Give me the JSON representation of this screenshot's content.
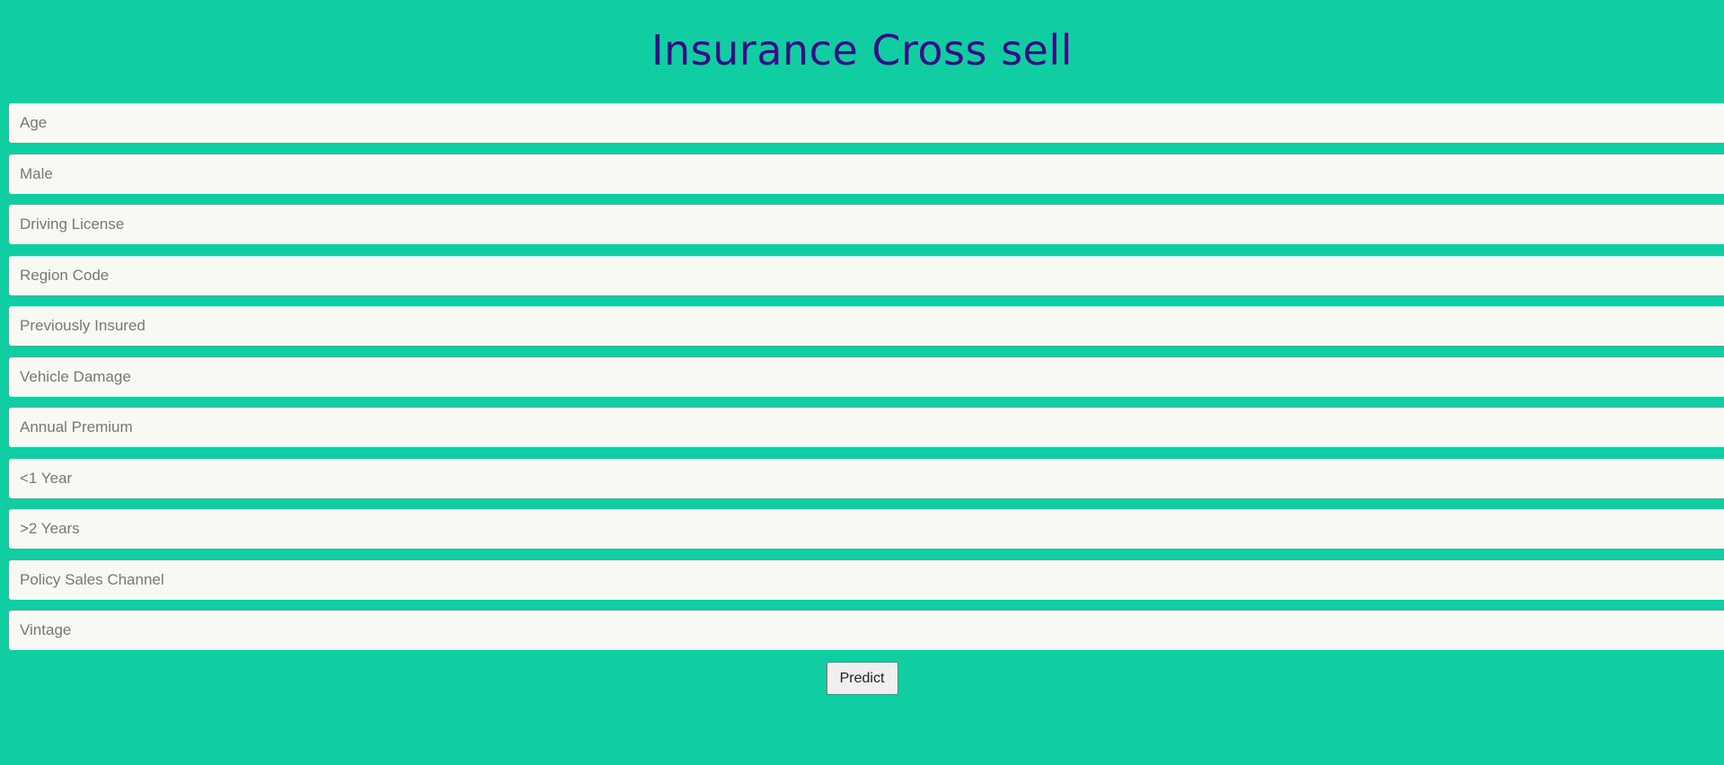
{
  "header": {
    "title": "Insurance Cross sell"
  },
  "form": {
    "fields": [
      {
        "placeholder": "Age"
      },
      {
        "placeholder": "Male"
      },
      {
        "placeholder": "Driving License"
      },
      {
        "placeholder": "Region Code"
      },
      {
        "placeholder": "Previously Insured"
      },
      {
        "placeholder": "Vehicle Damage"
      },
      {
        "placeholder": "Annual Premium"
      },
      {
        "placeholder": "<1 Year"
      },
      {
        "placeholder": ">2 Years"
      },
      {
        "placeholder": "Policy Sales Channel"
      },
      {
        "placeholder": "Vintage"
      }
    ],
    "submit_label": "Predict"
  },
  "colors": {
    "background": "#10cea1",
    "title": "#3b0c8a",
    "field_background": "#f8f9f3"
  }
}
